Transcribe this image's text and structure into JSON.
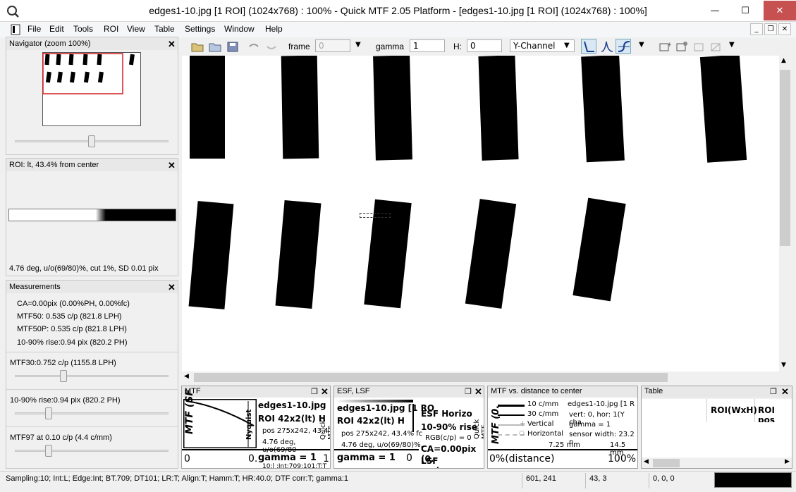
{
  "window": {
    "title": "edges1-10.jpg [1 ROI] (1024x768) : 100% - Quick MTF 2.05 Platform - [edges1-10.jpg [1 ROI] (1024x768) : 100%]",
    "minimize": "—",
    "maximize": "☐",
    "close": "✕"
  },
  "menu": [
    "File",
    "Edit",
    "Tools",
    "ROI",
    "View",
    "Table",
    "Settings",
    "Window",
    "Help"
  ],
  "mdi": {
    "minimize": "_",
    "restore": "❐",
    "close": "✕"
  },
  "navigator": {
    "title": "Navigator (zoom 100%)"
  },
  "roi_panel": {
    "title": "ROI: lt, 43.4% from center",
    "info": "4.76 deg, u/o(69/80)%, cut 1%, SD 0.01 pix"
  },
  "measurements": {
    "title": "Measurements",
    "lines": [
      "CA=0.00pix (0.00%PH, 0.00%fc)",
      "MTF50: 0.535 c/p (821.8 LPH)",
      "MTF50P: 0.535 c/p (821.8 LPH)",
      "10-90% rise:0.94 pix (820.2 PH)"
    ],
    "slider1_label": "MTF30:0.752 c/p (1155.8 LPH)",
    "slider2_label": "10-90% rise:0.94 pix (820.2 PH)",
    "slider3_label": "MTF97 at 0.10 c/p (4.4 c/mm)"
  },
  "toolbar": {
    "frame_label": "frame",
    "frame_value": "0",
    "gamma_label": "gamma",
    "gamma_value": "1",
    "h_label": "H:",
    "h_value": "0",
    "channel": "Y-Channel"
  },
  "mtf_panel": {
    "title": "MTF",
    "file": "edges1-10.jpg",
    "roi": "ROI 42x2(lt) H",
    "pos": "pos 275x242, 43.4",
    "deg": "4.76 deg, u/o(69/80",
    "gamma": "gamma = 1",
    "axis_min": "0",
    "axis_max": "0.",
    "axis_right": "1",
    "ylabel": "MTF (SF",
    "nyquist": "Nyquist",
    "side": "Quick MTF",
    "footer": "10:l :Int:709:101:T:T"
  },
  "esf_panel": {
    "title": "ESF, LSF",
    "file": "edges1-10.jpg [1 RO",
    "roi": "ROI 42x2(lt) H",
    "pos": "pos 275x242, 43.4% fc",
    "deg": "4.76 deg, u/o(69/80)%,",
    "gamma": "gamma = 1",
    "axis_zero": "0",
    "side": "Quick MTF",
    "esf": "ESF Horizo",
    "rise": "10-90% rise",
    "rgb": "RGB(c/p) = 0",
    "ca": "CA=0.00pix (0.",
    "lsf": "LSF variance:"
  },
  "dist_panel": {
    "title": "MTF vs. distance to center",
    "legend": [
      "10 c/mm",
      "30 c/mm",
      "Vertical",
      "Horizontal"
    ],
    "file": "edges1-10.jpg [1 R",
    "vert": "vert: 0, hor: 1(Y cha",
    "gamma": "gamma = 1",
    "sensor": "sensor width: 23.2 n",
    "mm1": "7.25 mm",
    "mm2": "14.5 mm",
    "xaxis": "0%(distance)",
    "xmax": "100%",
    "ylabel": "MTF (0."
  },
  "table_panel": {
    "title": "Table",
    "columns": [
      "ROI(WxH)",
      "ROI pos"
    ]
  },
  "status": {
    "settings": "Sampling:10; Int:L; Edge:Int; BT.709; DT101; LR:T; Align:T; Hamm:T; HR:40.0; DTF corr:T; gamma:1",
    "coords": "601, 241",
    "roi_pos": "43, 3",
    "rgb": "0, 0, 0"
  }
}
